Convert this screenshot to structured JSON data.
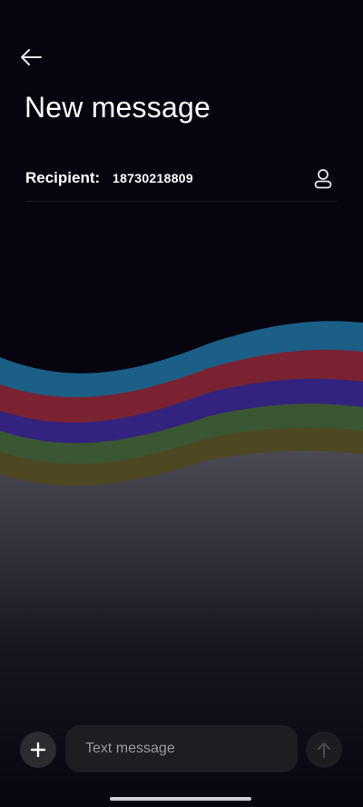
{
  "header": {
    "back_icon": "arrow-left-icon",
    "title": "New message"
  },
  "recipient": {
    "label": "Recipient:",
    "value": "18730218809",
    "contact_icon": "person-icon"
  },
  "composer": {
    "add_icon": "plus-icon",
    "placeholder": "Text message",
    "value": "",
    "send_icon": "arrow-up-icon"
  },
  "wallpaper": {
    "colors": [
      "#1b5f86",
      "#7a2232",
      "#33237e",
      "#3b5632",
      "#4d4722",
      "#3a3a44"
    ]
  }
}
